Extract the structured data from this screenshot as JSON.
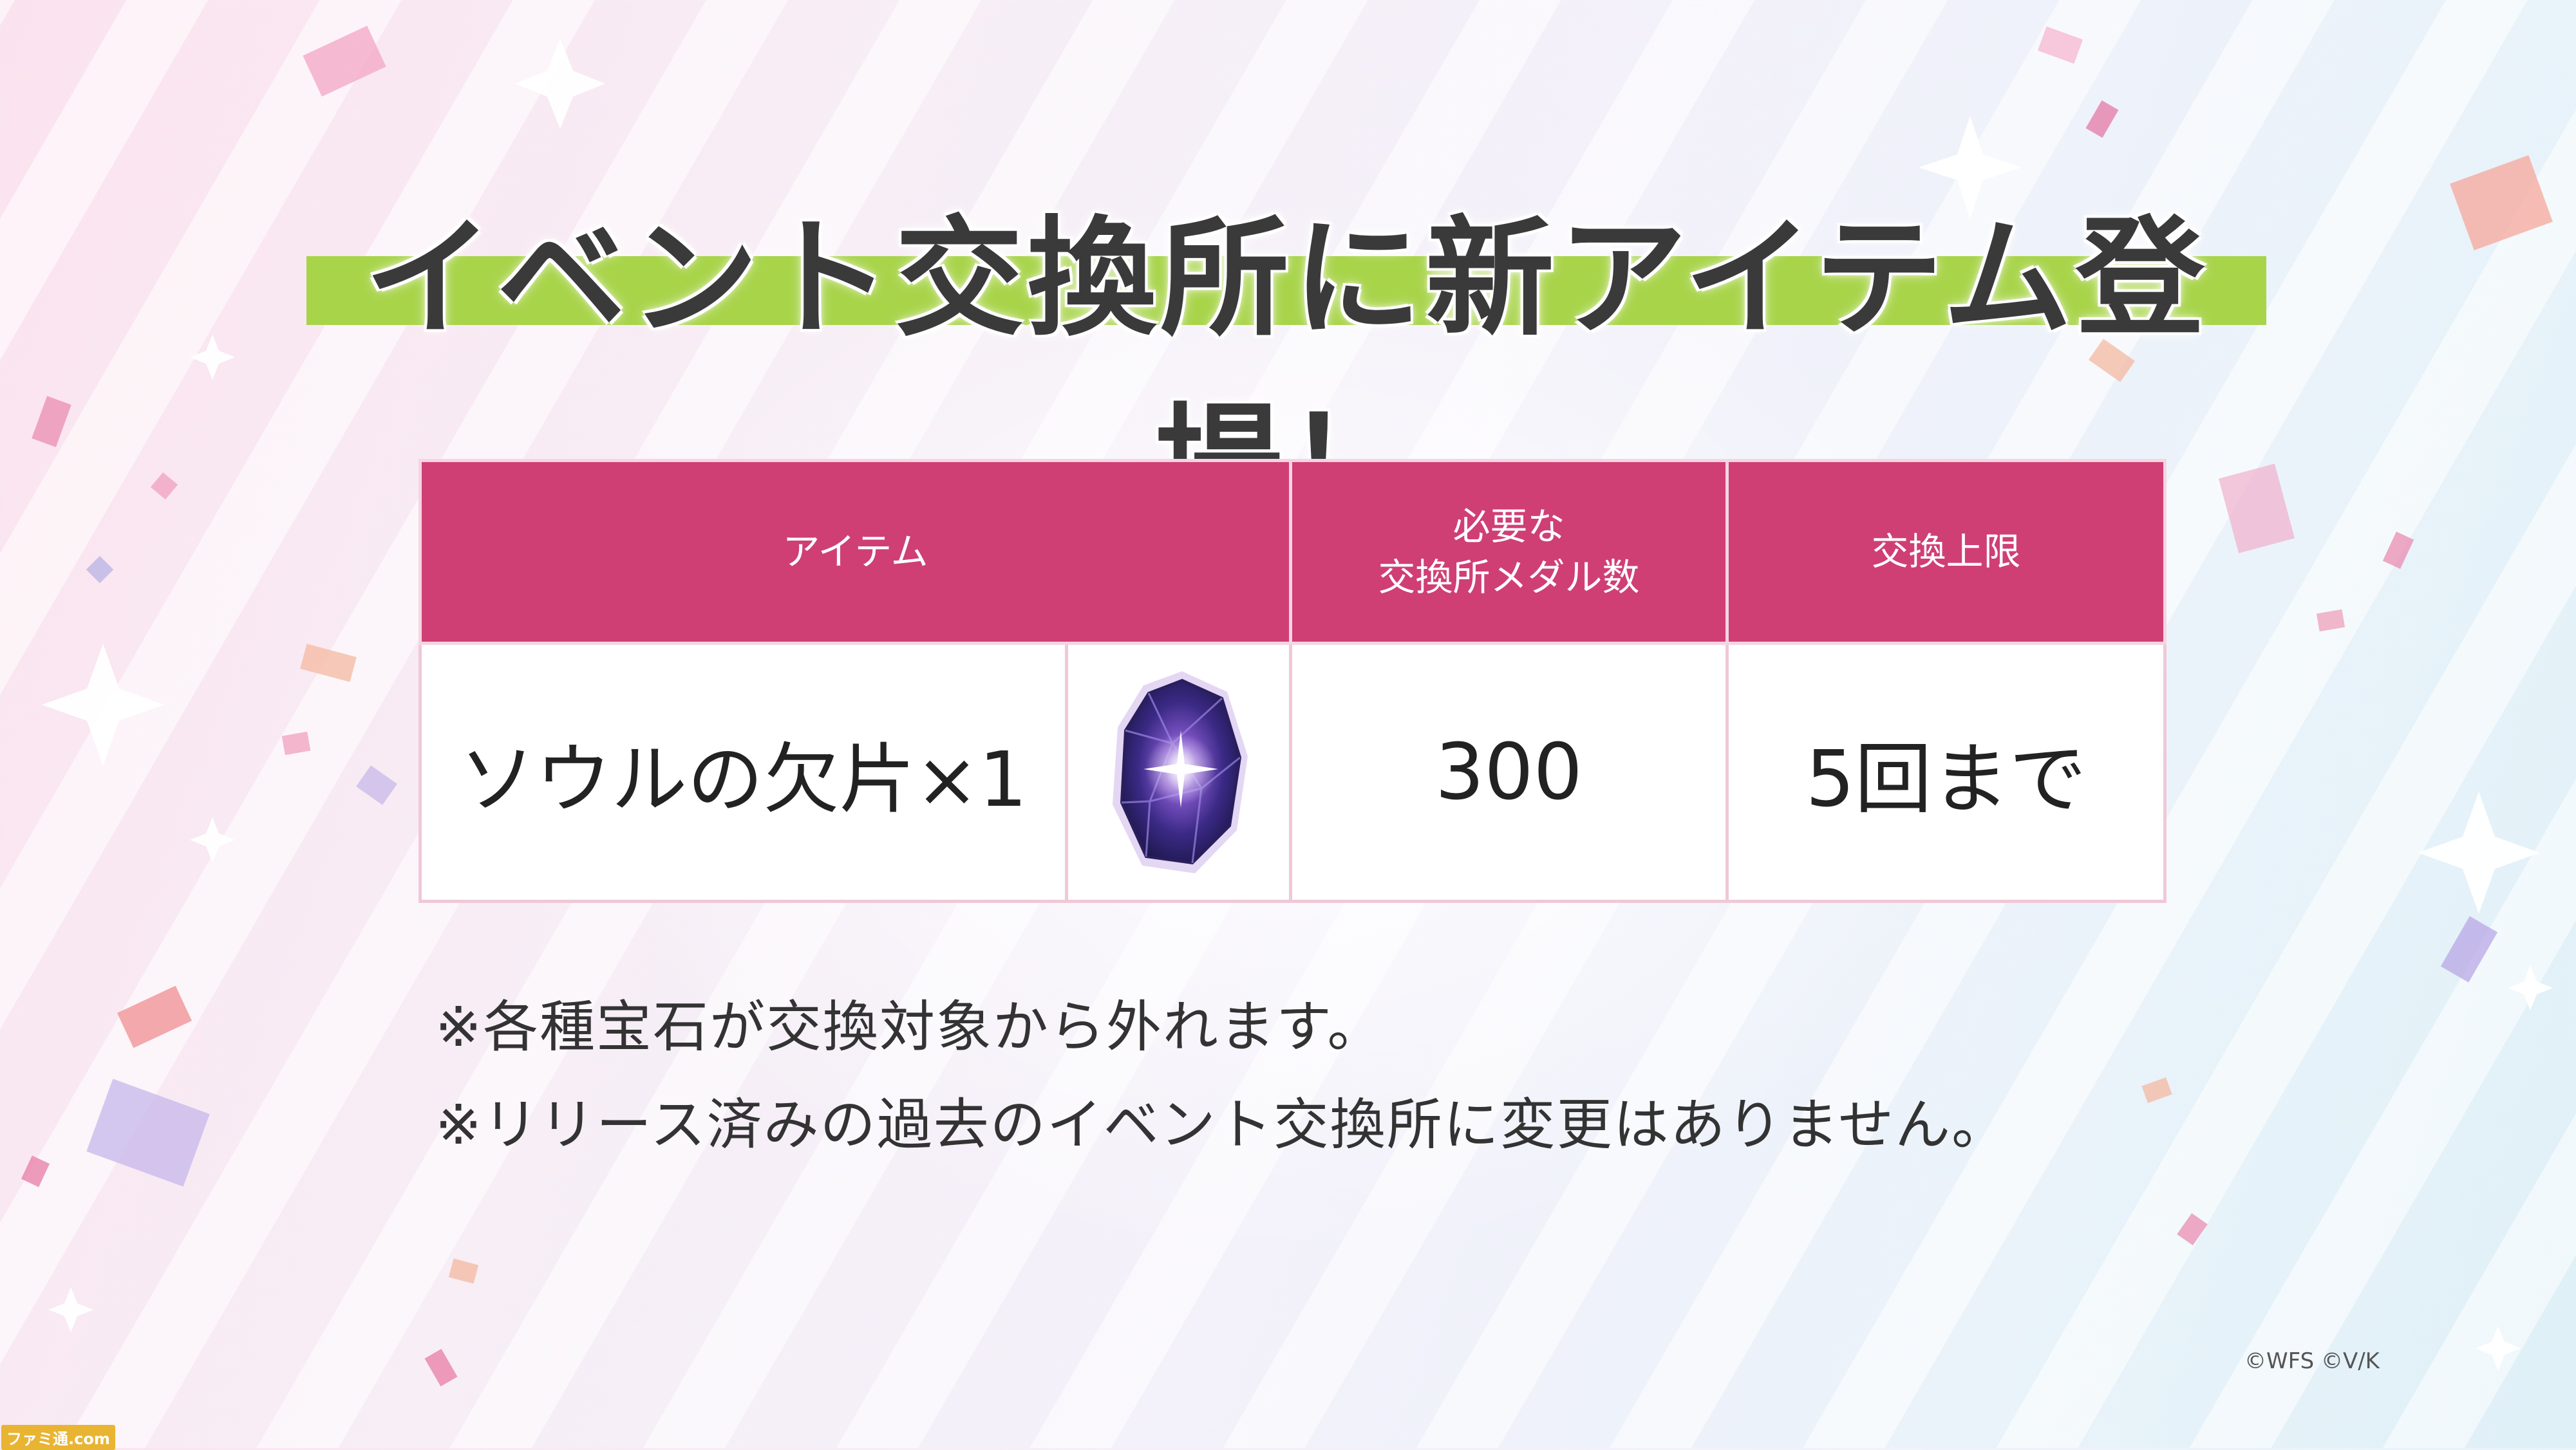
{
  "title": "イベント交換所に新アイテム登場！",
  "table": {
    "headers": {
      "item": "アイテム",
      "medals_line1": "必要な",
      "medals_line2": "交換所メダル数",
      "limit": "交換上限"
    },
    "row": {
      "item_name": "ソウルの欠片×1",
      "item_icon": "purple-gem-icon",
      "cost": "300",
      "limit": "5回まで"
    }
  },
  "notes": [
    "※各種宝石が交換対象から外れます。",
    "※リリース済みの過去のイベント交換所に変更はありません。"
  ],
  "copyright": "©WFS ©V/K",
  "watermark": "ファミ通.com",
  "colors": {
    "header_bg": "#cf3f74",
    "title_bar": "#a8d44a",
    "title_text": "#3a3a3a"
  }
}
